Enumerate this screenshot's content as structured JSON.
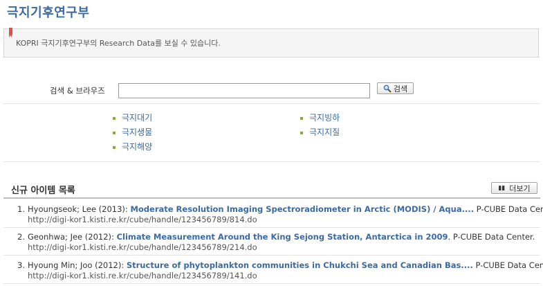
{
  "page": {
    "title": "극지기후연구부"
  },
  "notice": {
    "text": "KOPRI 극지기후연구부의 Research Data를 보실 수 있습니다."
  },
  "search": {
    "label": "검색 & 브라우즈",
    "button_label": "검색",
    "value": ""
  },
  "categories": {
    "left": [
      "극지대기",
      "극지생물",
      "극지해양"
    ],
    "right": [
      "극지빙하",
      "극지지질"
    ]
  },
  "recent": {
    "title": "신규 아이템 목록",
    "more_label": "더보기",
    "items": [
      {
        "number": "1.",
        "authors": "Hyoungseok; Lee (2013):",
        "title": "Moderate Resolution Imaging Spectroradiometer in Arctic (MODIS) / Aqua....",
        "publisher": "P-CUBE Data Center.",
        "url": "http://digi-kor1.kisti.re.kr/cube/handle/123456789/814.do"
      },
      {
        "number": "2.",
        "authors": "Geonhwa; Jee (2012):",
        "title": "Climate Measurement Around the King Sejong Station, Antarctica in 2009",
        "publisher": ". P-CUBE Data Center.",
        "url": "http://digi-kor1.kisti.re.kr/cube/handle/123456789/214.do"
      },
      {
        "number": "3.",
        "authors": "Hyoung Min; Joo (2012):",
        "title": "Structure of phytoplankton communities in Chukchi Sea and Canadian Bas....",
        "publisher": "P-CUBE Data Center.",
        "url": "http://digi-kor1.kisti.re.kr/cube/handle/123456789/141.do"
      }
    ]
  }
}
